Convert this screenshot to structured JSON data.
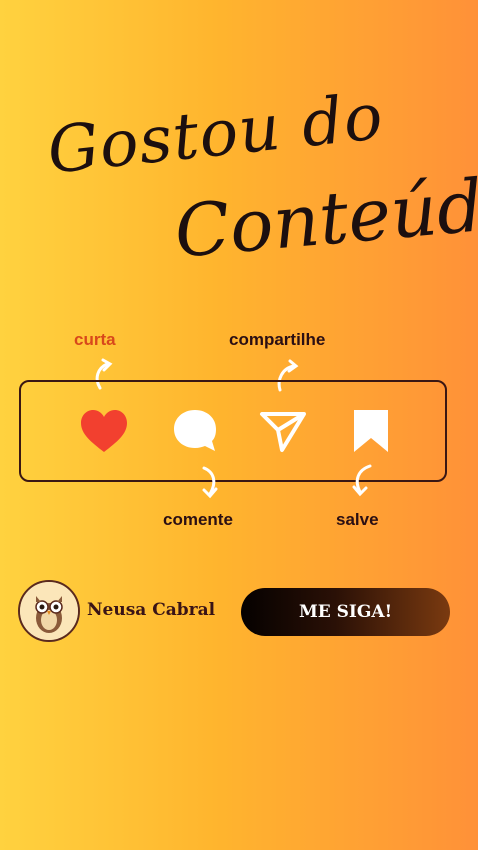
{
  "headline": {
    "line1": "Gostou do",
    "line2": "Conteúdo?"
  },
  "actions": {
    "like": "curta",
    "share": "compartilhe",
    "comment": "comente",
    "save": "salve"
  },
  "profile": {
    "name": "Neusa Cabral"
  },
  "cta": {
    "label": "ME SIGA!"
  },
  "colors": {
    "like": "#f2402f",
    "accent": "#d8481b",
    "text": "#2b0f13"
  },
  "icons": [
    "heart-icon",
    "comment-icon",
    "share-icon",
    "bookmark-icon"
  ]
}
